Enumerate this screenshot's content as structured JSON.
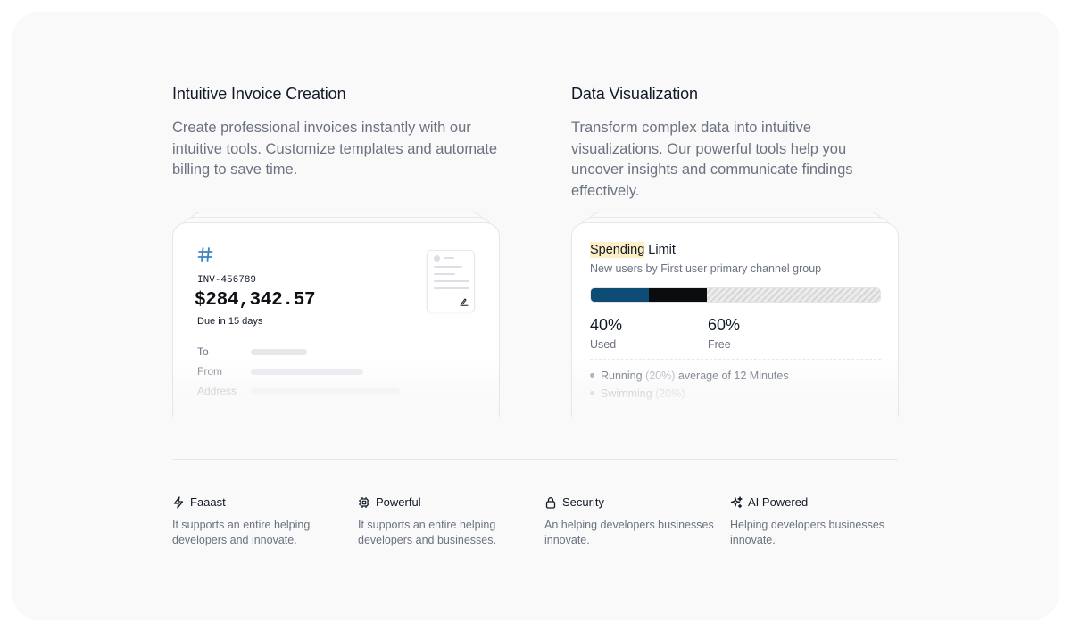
{
  "left": {
    "heading": "Intuitive Invoice Creation",
    "description": "Create professional invoices instantly with our intuitive tools. Customize templates and automate billing to save time.",
    "invoice": {
      "id": "INV-456789",
      "amount": "$284,342.57",
      "due": "Due in 15 days",
      "fields": [
        "To",
        "From",
        "Address"
      ],
      "hash_icon": "hash-icon",
      "document_icon": "document-icon"
    }
  },
  "right": {
    "heading": "Data Visualization",
    "description": "Transform complex data into intuitive visualizations. Our powerful tools help you uncover insights and communicate findings effectively.",
    "card": {
      "title_highlight": "Spending",
      "title_rest": " Limit",
      "subtitle": "New users by First user primary channel group",
      "used_percent": 40,
      "used_value": "40%",
      "used_label": "Used",
      "free_value": "60%",
      "free_label": "Free",
      "bar_colors": {
        "blue": "#0f4c75",
        "black": "#0b0c0e"
      },
      "bullets": [
        {
          "name": "Running",
          "pct": "(20%)",
          "extra": "average of 12 Minutes"
        },
        {
          "name": "Swimming",
          "pct": "(20%)",
          "extra": ""
        }
      ]
    }
  },
  "features": [
    {
      "icon": "bolt-icon",
      "title": "Faaast",
      "desc": "It supports an entire helping developers and innovate."
    },
    {
      "icon": "chip-icon",
      "title": "Powerful",
      "desc": "It supports an entire helping developers and businesses."
    },
    {
      "icon": "lock-icon",
      "title": "Security",
      "desc": "An helping developers businesses innovate."
    },
    {
      "icon": "sparkles-icon",
      "title": "AI Powered",
      "desc": "Helping developers businesses innovate."
    }
  ]
}
